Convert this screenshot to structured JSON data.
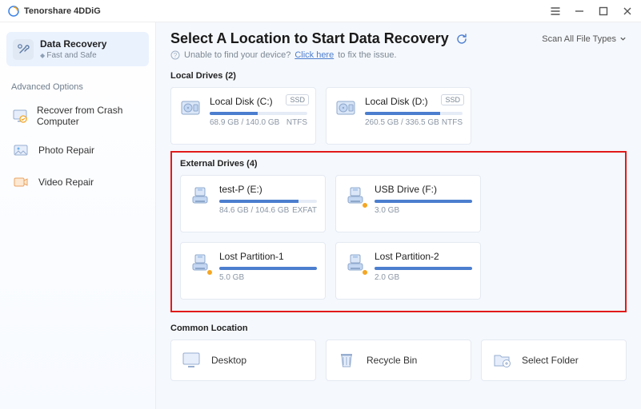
{
  "app": {
    "title": "Tenorshare 4DDiG"
  },
  "header": {
    "title": "Select A Location to Start Data Recovery",
    "scan_all": "Scan All File Types",
    "hint_prefix": "Unable to find your device?",
    "hint_link": "Click here",
    "hint_suffix": "to fix the issue."
  },
  "sidebar": {
    "main": {
      "label": "Data Recovery",
      "sub": "Fast and Safe"
    },
    "adv_label": "Advanced Options",
    "items": [
      {
        "label": "Recover from Crash Computer"
      },
      {
        "label": "Photo Repair"
      },
      {
        "label": "Video Repair"
      }
    ]
  },
  "sections": {
    "local_label": "Local Drives (2)",
    "external_label": "External Drives (4)",
    "common_label": "Common Location"
  },
  "local": [
    {
      "name": "Local Disk (C:)",
      "size": "68.9 GB / 140.0 GB",
      "fs": "NTFS",
      "badge": "SSD",
      "pct": 49
    },
    {
      "name": "Local Disk (D:)",
      "size": "260.5 GB / 336.5 GB",
      "fs": "NTFS",
      "badge": "SSD",
      "pct": 77
    }
  ],
  "external": [
    {
      "name": "test-P (E:)",
      "size": "84.6 GB / 104.6 GB",
      "fs": "EXFAT",
      "pct": 81,
      "warn": false
    },
    {
      "name": "USB Drive (F:)",
      "size": "3.0 GB",
      "fs": "",
      "pct": 100,
      "warn": true
    },
    {
      "name": "Lost Partition-1",
      "size": "5.0 GB",
      "fs": "",
      "pct": 100,
      "warn": true
    },
    {
      "name": "Lost Partition-2",
      "size": "2.0 GB",
      "fs": "",
      "pct": 100,
      "warn": true
    }
  ],
  "common": [
    {
      "label": "Desktop"
    },
    {
      "label": "Recycle Bin"
    },
    {
      "label": "Select Folder"
    }
  ]
}
